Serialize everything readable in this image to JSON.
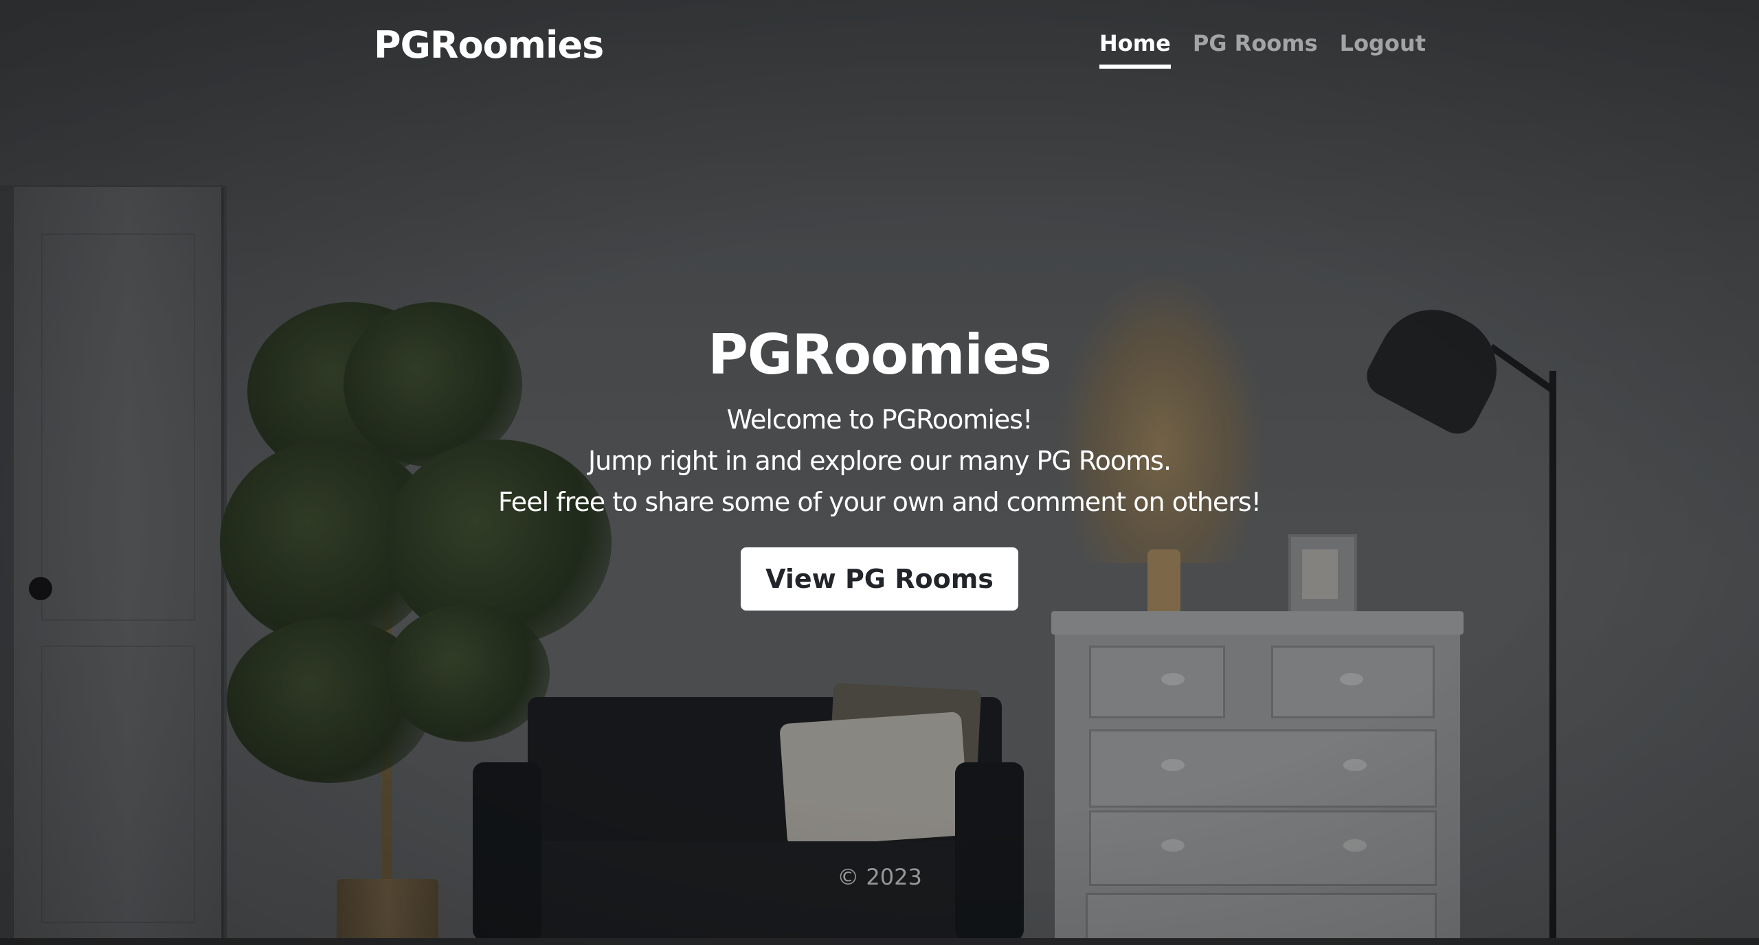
{
  "header": {
    "brand": "PGRoomies",
    "nav": [
      {
        "label": "Home",
        "active": true
      },
      {
        "label": "PG Rooms",
        "active": false
      },
      {
        "label": "Logout",
        "active": false
      }
    ]
  },
  "hero": {
    "title": "PGRoomies",
    "lines": [
      "Welcome to PGRoomies!",
      "Jump right in and explore our many PG Rooms.",
      "Feel free to share some of your own and comment on others!"
    ],
    "cta_label": "View PG Rooms"
  },
  "footer": {
    "text": "© 2023"
  },
  "colors": {
    "text_primary": "#ffffff",
    "text_muted": "rgba(255,255,255,0.55)",
    "button_bg": "#ffffff",
    "button_text": "#212529"
  }
}
